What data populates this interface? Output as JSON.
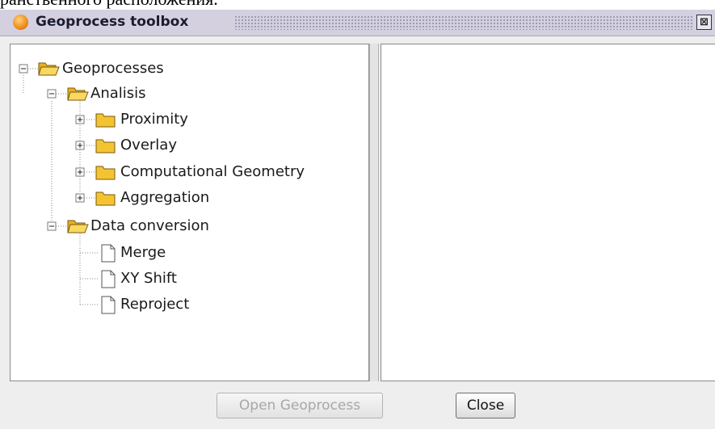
{
  "page": {
    "background_caption": "ранственного расположения."
  },
  "window": {
    "title": "Geoprocess toolbox",
    "close_glyph": "⊠"
  },
  "tree": {
    "root": "Geoprocesses",
    "analisis": "Analisis",
    "proximity": "Proximity",
    "overlay": "Overlay",
    "computational_geometry": "Computational Geometry",
    "aggregation": "Aggregation",
    "data_conversion": "Data conversion",
    "merge": "Merge",
    "xy_shift": "XY Shift",
    "reproject": "Reproject"
  },
  "buttons": {
    "open_geoprocess": "Open Geoprocess",
    "close": "Close"
  },
  "colors": {
    "titlebar": "#d4d0e0",
    "folder": "#f4c430",
    "window_bg": "#eeeeee"
  }
}
